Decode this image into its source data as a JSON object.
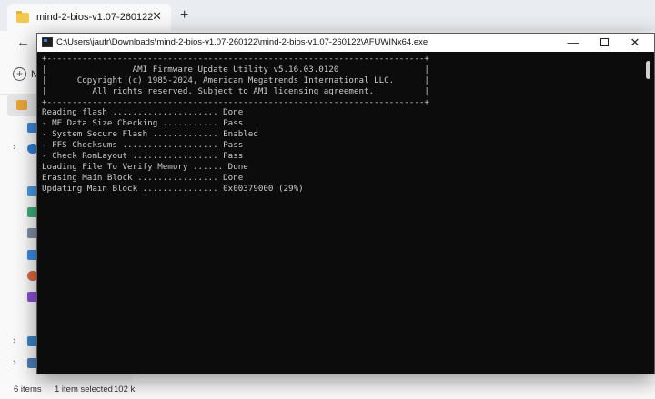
{
  "explorer": {
    "tab_title": "mind-2-bios-v1.07-260122",
    "tab_close": "✕",
    "new_tab": "+",
    "back": "←",
    "new_label": "N",
    "status": {
      "items": "6 items",
      "selected": "1 item selected",
      "size": "102 k"
    }
  },
  "console": {
    "title": "C:\\Users\\jaufr\\Downloads\\mind-2-bios-v1.07-260122\\mind-2-bios-v1.07-260122\\AFUWINx64.exe",
    "minimize": "—",
    "close": "✕",
    "lines": [
      "+---------------------------------------------------------------------------+",
      "|                 AMI Firmware Update Utility v5.16.03.0120                 |",
      "|      Copyright (c) 1985-2024, American Megatrends International LLC.      |",
      "|         All rights reserved. Subject to AMI licensing agreement.          |",
      "+---------------------------------------------------------------------------+",
      "Reading flash ..................... Done",
      "- ME Data Size Checking ........... Pass",
      "- System Secure Flash ............. Enabled",
      "- FFS Checksums ................... Pass",
      "- Check RomLayout ................. Pass",
      "Loading File To Verify Memory ...... Done",
      "Erasing Main Block ................ Done",
      "Updating Main Block ............... 0x00379000 (29%)"
    ]
  },
  "colors": {
    "console_bg": "#0c0c0c",
    "console_text": "#cccccc",
    "titlebar_bg": "#ffffff",
    "explorer_bg": "#f9f9f9"
  }
}
